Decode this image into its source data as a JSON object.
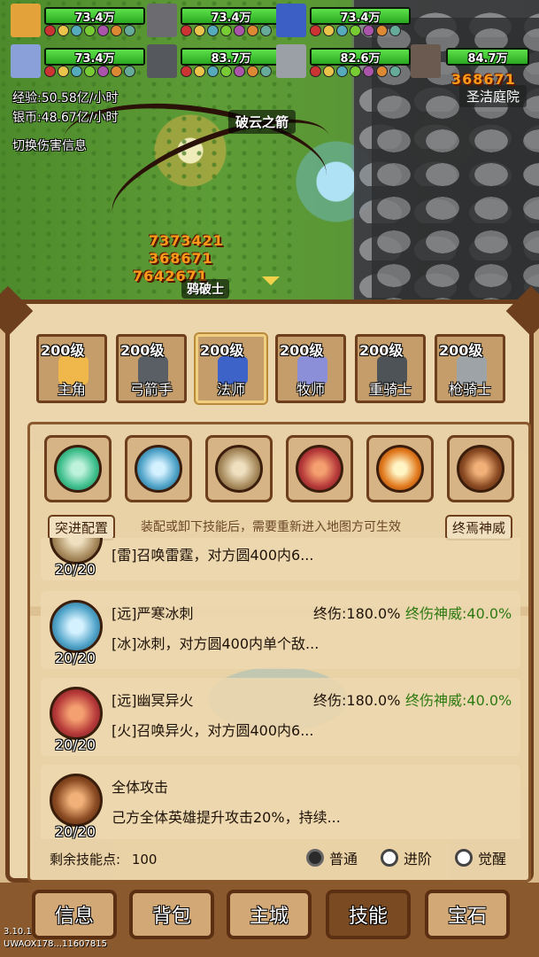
{
  "battle": {
    "heroes_hp": [
      {
        "hp": "73.4万",
        "fill": 1.0,
        "color": "#e4a23a"
      },
      {
        "hp": "73.4万",
        "fill": 1.0,
        "color": "#6b6b70"
      },
      {
        "hp": "73.4万",
        "fill": 1.0,
        "color": "#3b5fc4"
      },
      {
        "hp": "73.4万",
        "fill": 1.0,
        "color": "#8aa0d8"
      },
      {
        "hp": "83.7万",
        "fill": 1.0,
        "color": "#55595e"
      },
      {
        "hp": "82.6万",
        "fill": 1.0,
        "color": "#9aa0a6"
      },
      {
        "hp": "84.7万",
        "fill": 1.0,
        "color": "#6b5a50"
      }
    ],
    "exp_rate": "经验:50.58亿/小时",
    "silver_rate": "银币:48.67亿/小时",
    "toggle_damage": "切换伤害信息",
    "skill_popup": "破云之箭",
    "enemy_label": "鸦破士",
    "location": "圣洁庭院",
    "damage_numbers": [
      "7373421",
      "368671",
      "7642671",
      "368671"
    ]
  },
  "hero_tabs": [
    {
      "level": "200级",
      "name": "主角",
      "color": "#f0b84a",
      "active": false
    },
    {
      "level": "200级",
      "name": "弓箭手",
      "color": "#5a5f66",
      "active": false
    },
    {
      "level": "200级",
      "name": "法师",
      "color": "#3d62c8",
      "active": true
    },
    {
      "level": "200级",
      "name": "牧师",
      "color": "#8b8fd8",
      "active": false
    },
    {
      "level": "200级",
      "name": "重骑士",
      "color": "#4e5358",
      "active": false
    },
    {
      "level": "200级",
      "name": "枪骑士",
      "color": "#9ea3a8",
      "active": false
    }
  ],
  "equipped_skills": [
    {
      "icon": "green-orb-icon",
      "color": "#3fbf8c"
    },
    {
      "icon": "ice-orb-icon",
      "color": "#4fa3c8"
    },
    {
      "icon": "thunder-orb-icon",
      "color": "#a78a5c"
    },
    {
      "icon": "fire-orb-icon",
      "color": "#b73a3a"
    },
    {
      "icon": "meteor-orb-icon",
      "color": "#e27a1e"
    },
    {
      "icon": "fist-orb-icon",
      "color": "#8a4a22"
    }
  ],
  "controls": {
    "breakthrough": "突进配置",
    "hint": "装配或卸下技能后，需要重新进入地图方可生效",
    "ultimate": "终焉神威"
  },
  "skills": [
    {
      "name": "",
      "desc": "[雷]召唤雷霆，对方圆400内6...",
      "count": "20/20",
      "stat1": "",
      "stat2": "",
      "color": "#a78a5c"
    },
    {
      "name": "[远]严寒冰刺",
      "desc": "[冰]冰刺，对方圆400内单个敌...",
      "count": "20/20",
      "stat1": "终伤:180.0%",
      "stat2": "终伤神威:40.0%",
      "color": "#4fa3c8"
    },
    {
      "name": "[远]幽冥异火",
      "desc": "[火]召唤异火，对方圆400内6...",
      "count": "20/20",
      "stat1": "终伤:180.0%",
      "stat2": "终伤神威:40.0%",
      "color": "#b73a3a"
    },
    {
      "name": "全体攻击",
      "desc": "己方全体英雄提升攻击20%，持续...",
      "count": "20/20",
      "stat1": "",
      "stat2": "",
      "color": "#8a4a22"
    }
  ],
  "footer": {
    "points_label": "剩余技能点:",
    "points_value": "100",
    "modes": [
      "普通",
      "进阶",
      "觉醒"
    ]
  },
  "nav": [
    "信息",
    "背包",
    "主城",
    "技能",
    "宝石"
  ],
  "version": {
    "v": "3.10.1",
    "id": "UWAOX178...11607815"
  }
}
